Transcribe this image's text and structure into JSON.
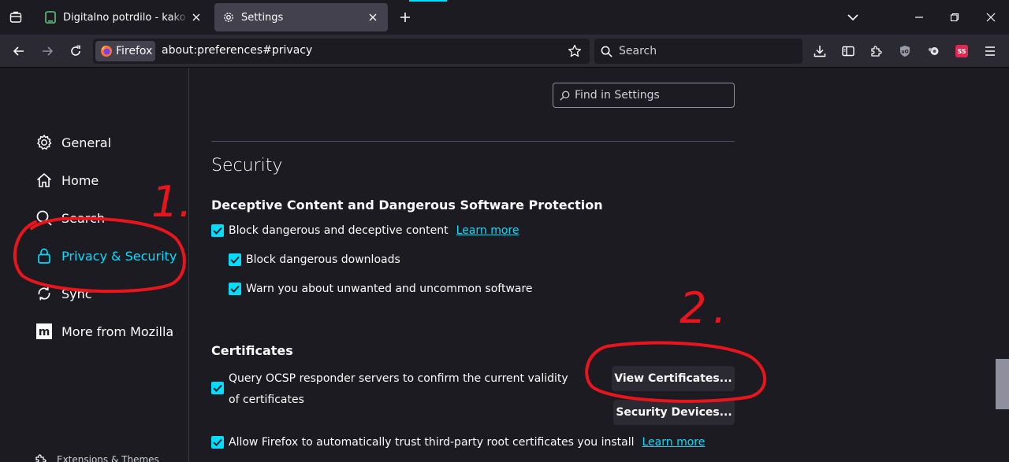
{
  "tabs": [
    {
      "title": "Digitalno potrdilo - kako pravilno",
      "active": false
    },
    {
      "title": "Settings",
      "active": true
    }
  ],
  "nav": {
    "identity_label": "Firefox",
    "url": "about:preferences#privacy",
    "search_placeholder": "Search"
  },
  "sidebar": {
    "items": [
      {
        "label": "General",
        "icon": "gear-icon"
      },
      {
        "label": "Home",
        "icon": "home-icon"
      },
      {
        "label": "Search",
        "icon": "search-icon"
      },
      {
        "label": "Privacy & Security",
        "icon": "lock-icon",
        "selected": true
      },
      {
        "label": "Sync",
        "icon": "sync-icon"
      },
      {
        "label": "More from Mozilla",
        "icon": "mozilla-icon"
      }
    ],
    "extensions_label": "Extensions & Themes"
  },
  "main": {
    "find_placeholder": "Find in Settings",
    "section_title": "Security",
    "deceptive": {
      "heading": "Deceptive Content and Dangerous Software Protection",
      "block_label": "Block dangerous and deceptive content",
      "learn_more": "Learn more",
      "downloads_label": "Block dangerous downloads",
      "unwanted_label": "Warn you about unwanted and uncommon software"
    },
    "certificates": {
      "heading": "Certificates",
      "ocsp_label": "Query OCSP responder servers to confirm the current validity of certificates",
      "view_button": "View Certificates...",
      "devices_button": "Security Devices...",
      "trust_label": "Allow Firefox to automatically trust third-party root certificates you install",
      "learn_more": "Learn more"
    }
  },
  "annotations": {
    "step1": "1.",
    "step2": "2."
  },
  "colors": {
    "accent": "#00ddff",
    "annotation": "#e8161c",
    "background": "#1c1b22",
    "toolbar": "#2b2a33"
  }
}
